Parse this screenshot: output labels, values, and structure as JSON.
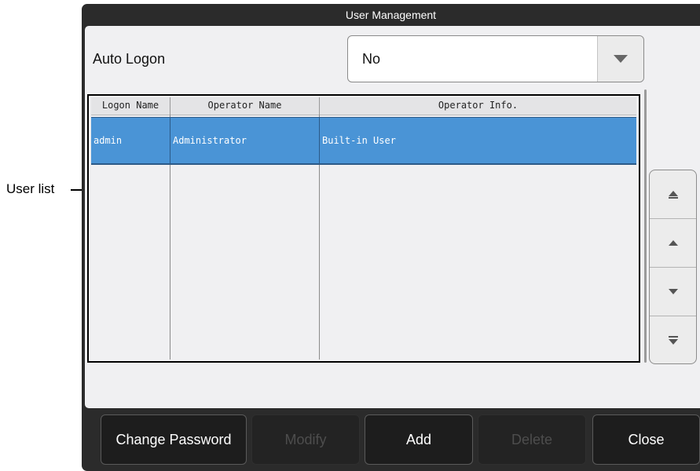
{
  "window": {
    "title": "User Management"
  },
  "auto_logon": {
    "label": "Auto Logon",
    "value": "No"
  },
  "user_list": {
    "columns": [
      "Logon Name",
      "Operator Name",
      "Operator Info."
    ],
    "rows": [
      [
        "admin",
        "Administrator",
        "Built-in User"
      ]
    ]
  },
  "buttons": {
    "change_password": "Change Password",
    "modify": "Modify",
    "add": "Add",
    "delete": "Delete",
    "close": "Close"
  },
  "callout": {
    "user_list": "User list"
  }
}
